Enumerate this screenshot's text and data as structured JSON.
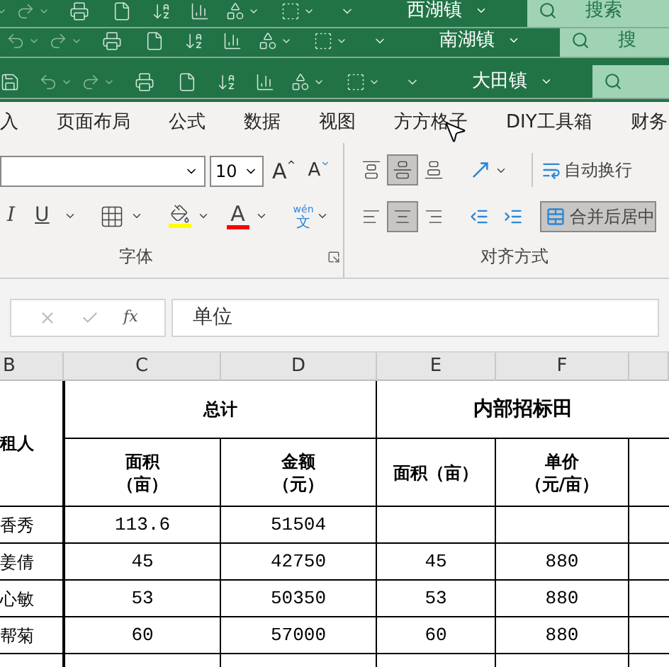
{
  "title_bars": [
    {
      "title": "西湖镇",
      "search": "搜索"
    },
    {
      "title": "南湖镇",
      "search": "搜"
    },
    {
      "title": "大田镇"
    }
  ],
  "ribbon_tabs": [
    "入",
    "页面布局",
    "公式",
    "数据",
    "视图",
    "方方格子",
    "DIY工具箱",
    "财务"
  ],
  "font_group": {
    "font_size": "10",
    "grow_font": "A",
    "shrink_font": "A",
    "italic": "I",
    "underline": "U",
    "font_color": "A",
    "phonetic_ruby": "wén",
    "phonetic_char": "文",
    "label": "字体"
  },
  "alignment_group": {
    "vertical": [
      {
        "selected": false
      },
      {
        "selected": true
      },
      {
        "selected": false
      }
    ],
    "horizontal": [
      {
        "selected": false
      },
      {
        "selected": true
      },
      {
        "selected": false
      }
    ],
    "wrap_text": "自动换行",
    "merge_center": {
      "label": "合并后居中",
      "selected": true
    },
    "label": "对齐方式"
  },
  "formula_bar": {
    "function_label": "fx",
    "value": "单位"
  },
  "columns": [
    "B",
    "C",
    "D",
    "E",
    "F"
  ],
  "sheet": {
    "first_header": "租人",
    "group_headers": [
      "总计",
      "内部招标田"
    ],
    "sub_headers": [
      [
        "面积",
        "（亩）"
      ],
      [
        "金额",
        "（元）"
      ],
      [
        "面积（亩）"
      ],
      [
        "单价",
        "（元/亩）"
      ]
    ],
    "rows": [
      [
        "香秀",
        "113.6",
        "51504",
        null,
        null
      ],
      [
        "姜倩",
        "45",
        "42750",
        "45",
        "880"
      ],
      [
        "心敏",
        "53",
        "50350",
        "53",
        "880"
      ],
      [
        "帮菊",
        "60",
        "57000",
        "60",
        "880"
      ]
    ]
  }
}
